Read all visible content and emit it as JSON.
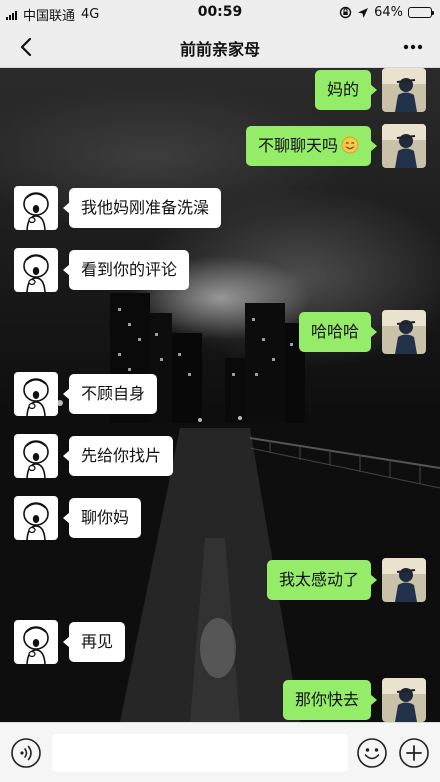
{
  "status_bar": {
    "carrier": "中国联通",
    "network": "4G",
    "time": "00:59",
    "battery": "64%",
    "battery_level": 0.64
  },
  "nav": {
    "title": "前前亲家母",
    "back_icon": "chevron-left-icon",
    "more_icon": "more-dots-icon"
  },
  "messages": [
    {
      "side": "right",
      "text": "妈的"
    },
    {
      "side": "right",
      "text": "不聊聊天吗",
      "emoji": "smile-emoji"
    },
    {
      "side": "left",
      "text": "我他妈刚准备洗澡"
    },
    {
      "side": "left",
      "text": "看到你的评论"
    },
    {
      "side": "right",
      "text": "哈哈哈"
    },
    {
      "side": "left",
      "text": "不顾自身"
    },
    {
      "side": "left",
      "text": "先给你找片"
    },
    {
      "side": "left",
      "text": "聊你妈"
    },
    {
      "side": "right",
      "text": "我太感动了"
    },
    {
      "side": "left",
      "text": "再见"
    },
    {
      "side": "right",
      "text": "那你快去"
    }
  ],
  "input": {
    "value": "",
    "voice_icon": "voice-icon",
    "emoji_icon": "emoji-icon",
    "plus_icon": "plus-icon"
  },
  "colors": {
    "sent_bubble": "#95ec69",
    "received_bubble": "#ffffff",
    "bar_background": "#ededed"
  }
}
